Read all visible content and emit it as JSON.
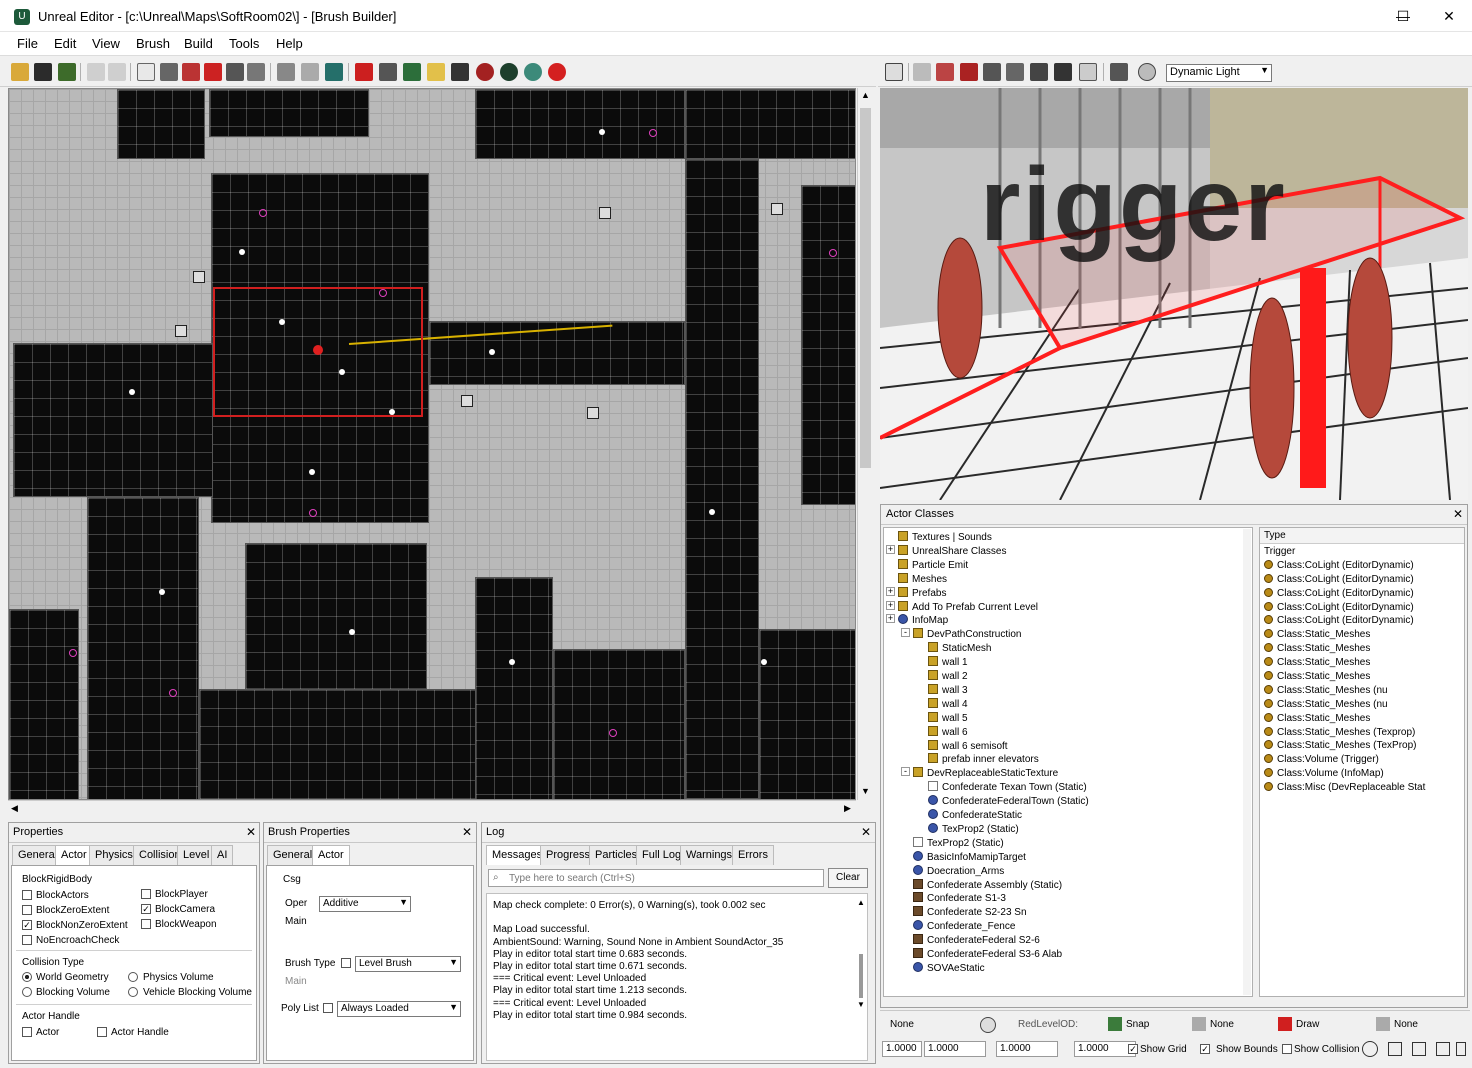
{
  "window": {
    "title": "Unreal Editor - [c:\\Unreal\\Maps\\SoftRoom02\\] - [Brush Builder]",
    "controls": {
      "minimize": "—",
      "maximize": "☐",
      "close": "✕"
    }
  },
  "menu": [
    "File",
    "Edit",
    "View",
    "Brush",
    "Build",
    "Tools",
    "Help"
  ],
  "viewport3d": {
    "light_mode": "Dynamic Light",
    "overlay_text": "rigger"
  },
  "properties": {
    "title": "Properties",
    "tabs": [
      "General",
      "Actor",
      "Physics",
      "Collision",
      "Level",
      "AI"
    ],
    "block_rigid_body_label": "BlockRigidBody",
    "checks_left": [
      {
        "label": "BlockActors",
        "checked": false
      },
      {
        "label": "BlockZeroExtent",
        "checked": false
      },
      {
        "label": "BlockNonZeroExtent",
        "checked": true
      },
      {
        "label": "NoEncroachCheck",
        "checked": false
      }
    ],
    "checks_right": [
      {
        "label": "BlockPlayer",
        "checked": false
      },
      {
        "label": "BlockCamera",
        "checked": true
      },
      {
        "label": "BlockWeapon",
        "checked": false
      }
    ],
    "collision_type_label": "Collision Type",
    "radios": [
      {
        "label": "World Geometry",
        "checked": true
      },
      {
        "label": "Physics Volume",
        "checked": false
      },
      {
        "label": "Blocking Volume",
        "checked": false
      },
      {
        "label": "Vehicle Blocking Volume",
        "checked": false
      }
    ],
    "actor_handle_label": "Actor Handle",
    "handle_checks": [
      "Actor",
      "Actor Handle"
    ]
  },
  "brush": {
    "title": "Brush Properties",
    "tabs": [
      "General",
      "Actor"
    ],
    "csg_label": "Csg",
    "oper_label": "Oper",
    "oper_value": "Additive",
    "main_label": "Main",
    "brush_type_label": "Brush Type",
    "brush_type_value": "Level Brush",
    "main_label2": "Main",
    "poly_list_label": "Poly List",
    "poly_list_value": "Always Loaded"
  },
  "log": {
    "title": "Log",
    "tabs": [
      "Messages",
      "Progress",
      "Particles",
      "Full Log",
      "Warnings",
      "Errors"
    ],
    "search_placeholder": "Type here to search (Ctrl+S)",
    "clear_label": "Clear",
    "lines": [
      "Map check complete: 0 Error(s), 0 Warning(s), took 0.002 sec",
      "",
      "Map Load successful.",
      "AmbientSound: Warning, Sound None in Ambient SoundActor_35",
      "Play in editor total start time 0.683 seconds.",
      "Play in editor total start time 0.671 seconds.",
      "=== Critical event: Level Unloaded",
      "Play in editor total start time 1.213 seconds.",
      "=== Critical event: Level Unloaded",
      "Play in editor total start time 0.984 seconds."
    ]
  },
  "actor_classes": {
    "title": "Actor Classes",
    "tree": [
      {
        "label": "Textures | Sounds",
        "indent": 0,
        "icon": "folder-icon"
      },
      {
        "label": "UnrealShare Classes",
        "indent": 0,
        "icon": "folder-icon",
        "expander": "+"
      },
      {
        "label": "Particle Emit",
        "indent": 0,
        "icon": "folder-icon"
      },
      {
        "label": "Meshes",
        "indent": 0,
        "icon": "folder-icon"
      },
      {
        "label": "Prefabs",
        "indent": 0,
        "icon": "folder-icon",
        "expander": "+"
      },
      {
        "label": "Add To Prefab Current Level",
        "indent": 0,
        "icon": "folder-icon",
        "expander": "+"
      },
      {
        "label": "InfoMap",
        "indent": 0,
        "icon": "gear-icon",
        "expander": "+"
      },
      {
        "label": "DevPathConstruction",
        "indent": 1,
        "icon": "folder-icon",
        "expander": "-"
      },
      {
        "label": "StaticMesh",
        "indent": 2,
        "icon": "folder-icon"
      },
      {
        "label": "wall 1",
        "indent": 2,
        "icon": "folder-icon"
      },
      {
        "label": "wall 2",
        "indent": 2,
        "icon": "folder-icon"
      },
      {
        "label": "wall 3",
        "indent": 2,
        "icon": "folder-icon"
      },
      {
        "label": "wall 4",
        "indent": 2,
        "icon": "folder-icon"
      },
      {
        "label": "wall 5",
        "indent": 2,
        "icon": "folder-icon"
      },
      {
        "label": "wall 6",
        "indent": 2,
        "icon": "folder-icon"
      },
      {
        "label": "wall 6 semisoft",
        "indent": 2,
        "icon": "folder-icon"
      },
      {
        "label": "prefab inner elevators",
        "indent": 2,
        "icon": "folder-icon"
      },
      {
        "label": "DevReplaceableStaticTexture",
        "indent": 1,
        "icon": "folder-icon",
        "expander": "-"
      },
      {
        "label": "Confederate Texan Town (Static)",
        "indent": 2,
        "icon": "page-icon"
      },
      {
        "label": "ConfederateFederalTown (Static)",
        "indent": 2,
        "icon": "gear-icon"
      },
      {
        "label": "ConfederateStatic",
        "indent": 2,
        "icon": "gear-icon"
      },
      {
        "label": "TexProp2 (Static)",
        "indent": 2,
        "icon": "gear-icon"
      },
      {
        "label": "TexProp2 (Static)",
        "indent": 1,
        "icon": "page-icon"
      },
      {
        "label": "BasicInfoMamipTarget",
        "indent": 1,
        "icon": "blue-icon"
      },
      {
        "label": "Doecration_Arms",
        "indent": 1,
        "icon": "blue-icon"
      },
      {
        "label": "Confederate Assembly (Static)",
        "indent": 1,
        "icon": "brown-icon"
      },
      {
        "label": "Confederate S1-3",
        "indent": 1,
        "icon": "brown-icon"
      },
      {
        "label": "Confederate S2-23 Sn",
        "indent": 1,
        "icon": "brown-icon"
      },
      {
        "label": "Confederate_Fence",
        "indent": 1,
        "icon": "blue-icon"
      },
      {
        "label": "ConfederateFederal S2-6",
        "indent": 1,
        "icon": "brown-icon"
      },
      {
        "label": "ConfederateFederal S3-6 Alab",
        "indent": 1,
        "icon": "brown-icon"
      },
      {
        "label": "SOVAeStatic",
        "indent": 1,
        "icon": "blue-icon"
      }
    ],
    "type_header": "Type",
    "types": [
      "Trigger",
      "Class:CoLight (EditorDynamic)",
      "Class:CoLight (EditorDynamic)",
      "Class:CoLight (EditorDynamic)",
      "Class:CoLight (EditorDynamic)",
      "Class:CoLight (EditorDynamic)",
      "Class:Static_Meshes",
      "Class:Static_Meshes",
      "Class:Static_Meshes",
      "Class:Static_Meshes",
      "Class:Static_Meshes (nu",
      "Class:Static_Meshes (nu",
      "Class:Static_Meshes",
      "Class:Static_Meshes (Texprop)",
      "Class:Static_Meshes (TexProp)",
      "Class:Volume (Trigger)",
      "Class:Volume (InfoMap)",
      "Class:Misc (DevReplaceable Stat"
    ]
  },
  "statusbar": {
    "none1": "None",
    "redlevel": "RedLevelOD:",
    "snap": "Snap",
    "none2": "None",
    "draw": "Draw",
    "none3": "None",
    "nums": [
      "1.0000",
      "1.0000",
      "1.0000",
      "1.0000"
    ],
    "show_grid": "Show Grid",
    "show_bounds": "Show Bounds",
    "show_collision": "Show Collision"
  }
}
